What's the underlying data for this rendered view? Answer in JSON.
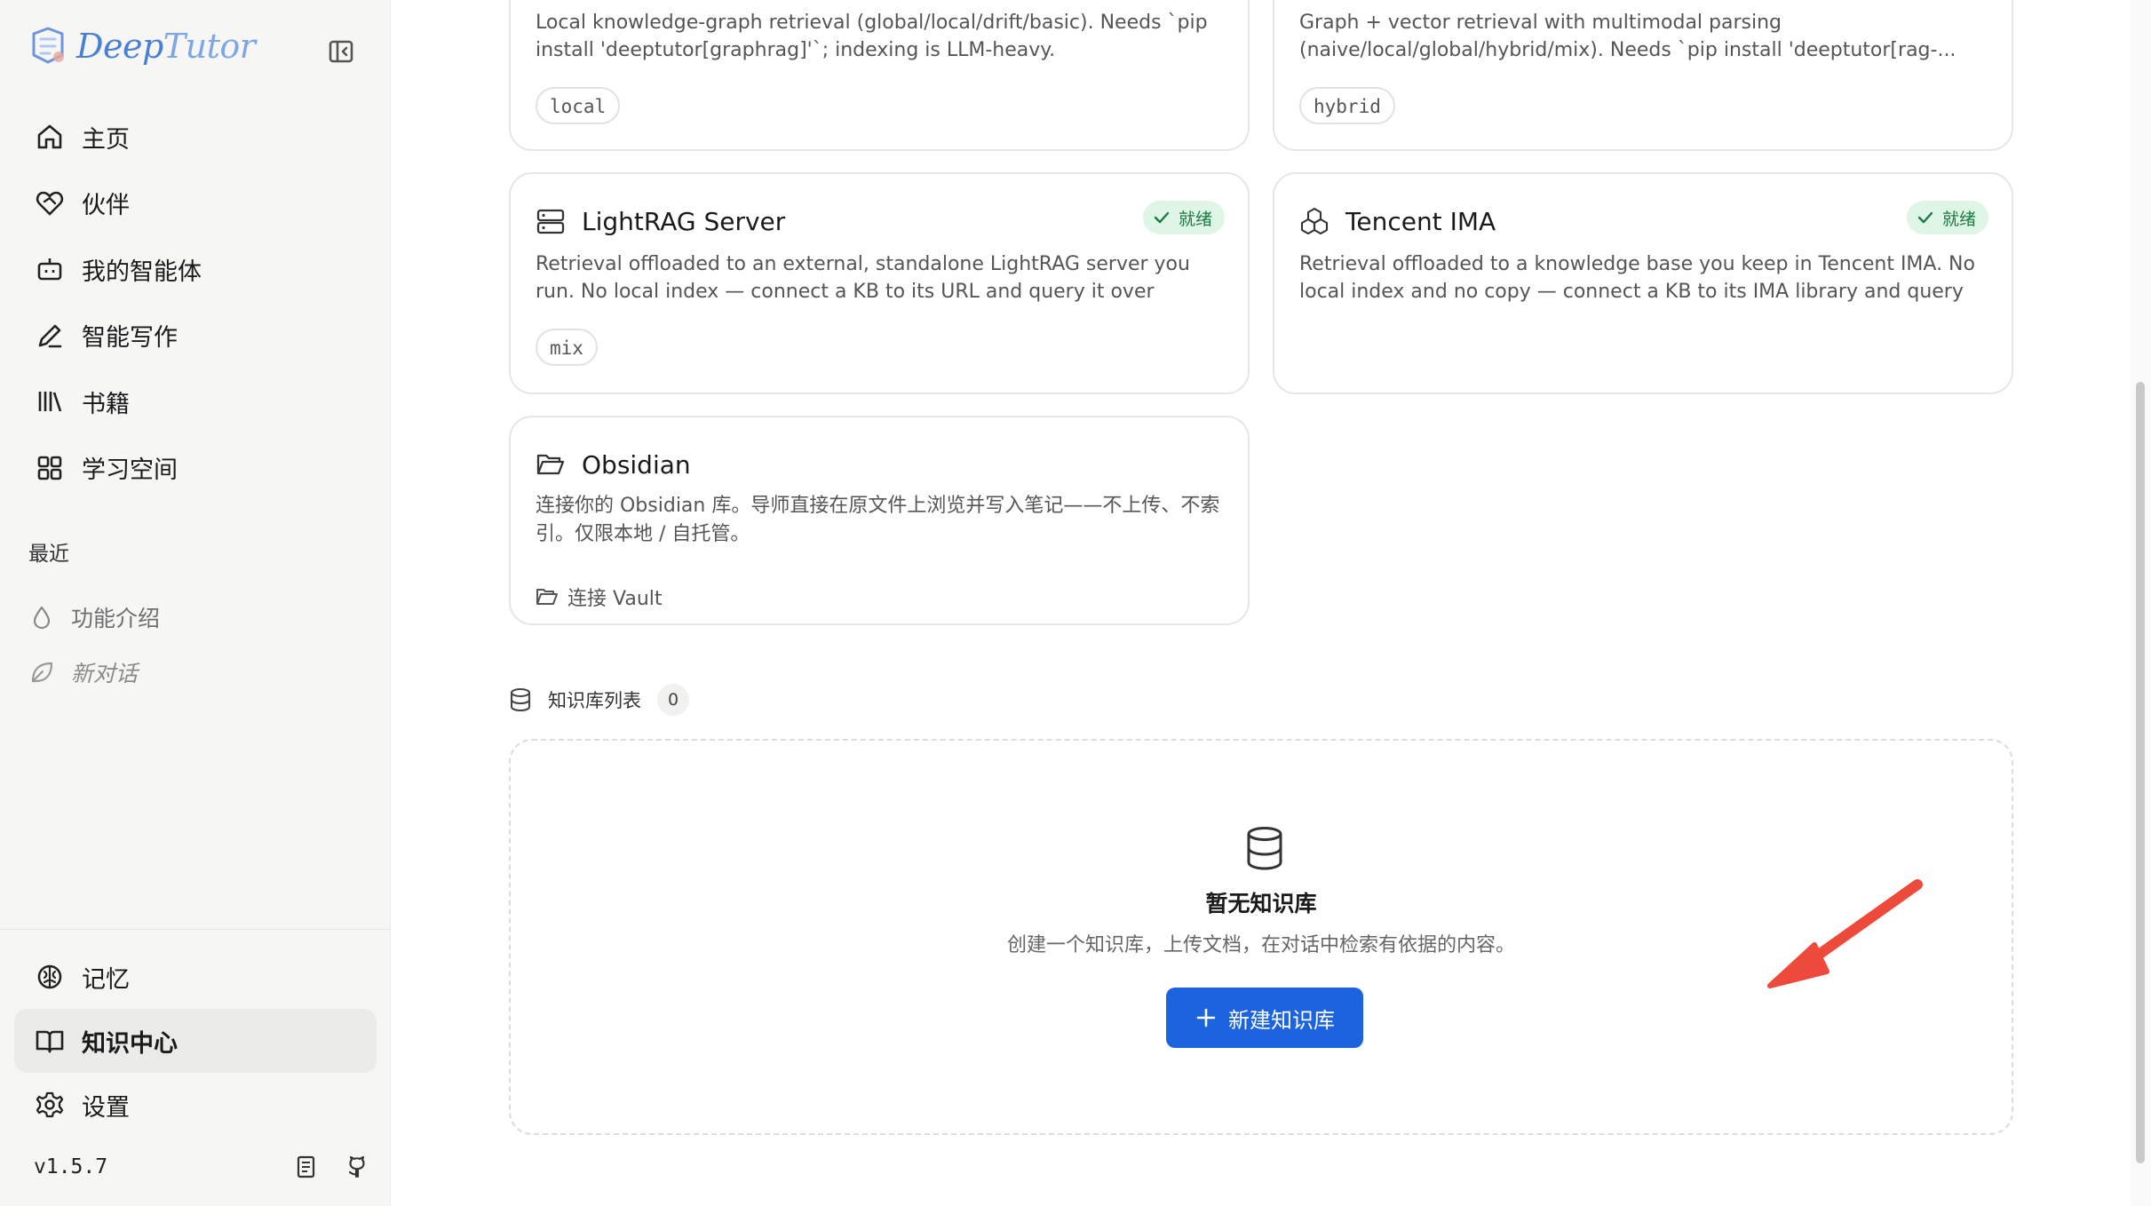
{
  "app": {
    "brand_deep": "Deep",
    "brand_tutor": "Tutor",
    "version": "v1.5.7"
  },
  "sidebar": {
    "items": [
      {
        "label": "主页"
      },
      {
        "label": "伙伴"
      },
      {
        "label": "我的智能体"
      },
      {
        "label": "智能写作"
      },
      {
        "label": "书籍"
      },
      {
        "label": "学习空间"
      }
    ],
    "recent_heading": "最近",
    "recent": [
      {
        "label": "功能介绍"
      },
      {
        "label": "新对话"
      }
    ],
    "bottom": [
      {
        "label": "记忆"
      },
      {
        "label": "知识中心"
      },
      {
        "label": "设置"
      }
    ]
  },
  "providers": {
    "graphrag": {
      "description": "Local knowledge-graph retrieval (global/local/drift/basic). Needs `pip install 'deeptutor[graphrag]'`; indexing is LLM-heavy.",
      "mode": "local"
    },
    "raganything": {
      "description": "Graph + vector retrieval with multimodal parsing (naive/local/global/hybrid/mix). Needs `pip install 'deeptutor[rag-...",
      "mode": "hybrid"
    },
    "lightrag": {
      "name": "LightRAG Server",
      "status": "就绪",
      "description": "Retrieval offloaded to an external, standalone LightRAG server you run. No local index — connect a KB to its URL and query it over HTTP...",
      "mode": "mix"
    },
    "tencent": {
      "name": "Tencent IMA",
      "status": "就绪",
      "description": "Retrieval offloaded to a knowledge base you keep in Tencent IMA. No local index and no copy — connect a KB to its IMA library and query it..."
    },
    "obsidian": {
      "name": "Obsidian",
      "description": "连接你的 Obsidian 库。导师直接在原文件上浏览并写入笔记——不上传、不索引。仅限本地 / 自托管。",
      "action": "连接 Vault"
    }
  },
  "kb_list": {
    "heading": "知识库列表",
    "count": "0",
    "empty_title": "暂无知识库",
    "empty_desc": "创建一个知识库，上传文档，在对话中检索有依据的内容。",
    "create_label": "新建知识库"
  },
  "colors": {
    "accent": "#1c63e0",
    "ready_bg": "#dff5e6",
    "ready_text": "#1b7a43",
    "annotation": "#ee4a3c"
  }
}
